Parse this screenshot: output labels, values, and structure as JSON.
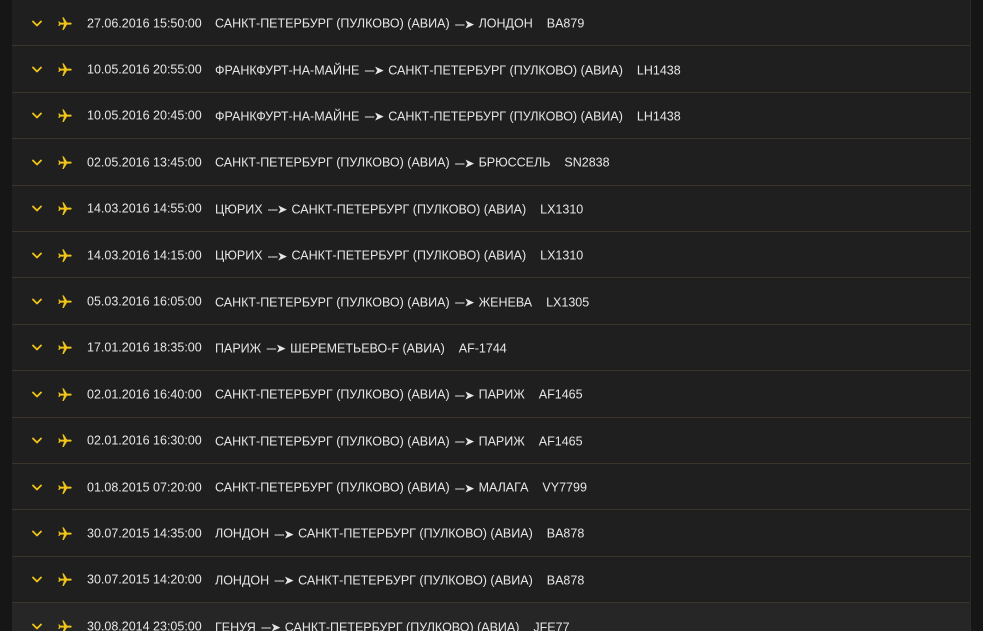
{
  "colors": {
    "accent": "#f0c419",
    "background": "#1f1f1f",
    "divider": "#3a3528",
    "text": "#e6e6e6"
  },
  "icons": {
    "expand": "chevron-down-icon",
    "flight": "airplane-icon"
  },
  "flights": [
    {
      "datetime": "27.06.2016 15:50:00",
      "from": "САНКТ-ПЕТЕРБУРГ (ПУЛКОВО) (АВИА)",
      "arrow": "---➤",
      "to": "ЛОНДОН",
      "flight": "BA879"
    },
    {
      "datetime": "10.05.2016 20:55:00",
      "from": "ФРАНКФУРТ-НА-МАЙНЕ",
      "arrow": "---➤",
      "to": "САНКТ-ПЕТЕРБУРГ (ПУЛКОВО) (АВИА)",
      "flight": "LH1438"
    },
    {
      "datetime": "10.05.2016 20:45:00",
      "from": "ФРАНКФУРТ-НА-МАЙНЕ",
      "arrow": "---➤",
      "to": "САНКТ-ПЕТЕРБУРГ (ПУЛКОВО) (АВИА)",
      "flight": "LH1438"
    },
    {
      "datetime": "02.05.2016 13:45:00",
      "from": "САНКТ-ПЕТЕРБУРГ (ПУЛКОВО) (АВИА)",
      "arrow": "---➤",
      "to": "БРЮССЕЛЬ",
      "flight": "SN2838"
    },
    {
      "datetime": "14.03.2016 14:55:00",
      "from": "ЦЮРИХ",
      "arrow": "---➤",
      "to": "САНКТ-ПЕТЕРБУРГ (ПУЛКОВО) (АВИА)",
      "flight": "LX1310"
    },
    {
      "datetime": "14.03.2016 14:15:00",
      "from": "ЦЮРИХ",
      "arrow": "---➤",
      "to": "САНКТ-ПЕТЕРБУРГ (ПУЛКОВО) (АВИА)",
      "flight": "LX1310"
    },
    {
      "datetime": "05.03.2016 16:05:00",
      "from": "САНКТ-ПЕТЕРБУРГ (ПУЛКОВО) (АВИА)",
      "arrow": "---➤",
      "to": "ЖЕНЕВА",
      "flight": "LX1305"
    },
    {
      "datetime": "17.01.2016 18:35:00",
      "from": "ПАРИЖ",
      "arrow": "---➤",
      "to": "ШЕРЕМЕТЬЕВО-F (АВИА)",
      "flight": "AF-1744"
    },
    {
      "datetime": "02.01.2016 16:40:00",
      "from": "САНКТ-ПЕТЕРБУРГ (ПУЛКОВО) (АВИА)",
      "arrow": "---➤",
      "to": "ПАРИЖ",
      "flight": "AF1465"
    },
    {
      "datetime": "02.01.2016 16:30:00",
      "from": "САНКТ-ПЕТЕРБУРГ (ПУЛКОВО) (АВИА)",
      "arrow": "---➤",
      "to": "ПАРИЖ",
      "flight": "AF1465"
    },
    {
      "datetime": "01.08.2015 07:20:00",
      "from": "САНКТ-ПЕТЕРБУРГ (ПУЛКОВО) (АВИА)",
      "arrow": "---➤",
      "to": "МАЛАГА",
      "flight": "VY7799"
    },
    {
      "datetime": "30.07.2015 14:35:00",
      "from": "ЛОНДОН",
      "arrow": "---➤",
      "to": "САНКТ-ПЕТЕРБУРГ (ПУЛКОВО) (АВИА)",
      "flight": "BA878"
    },
    {
      "datetime": "30.07.2015 14:20:00",
      "from": "ЛОНДОН",
      "arrow": "---➤",
      "to": "САНКТ-ПЕТЕРБУРГ (ПУЛКОВО) (АВИА)",
      "flight": "BA878"
    },
    {
      "datetime": "30.08.2014 23:05:00",
      "from": "ГЕНУЯ",
      "arrow": "---➤",
      "to": "САНКТ-ПЕТЕРБУРГ (ПУЛКОВО) (АВИА)",
      "flight": "JFE77"
    }
  ]
}
